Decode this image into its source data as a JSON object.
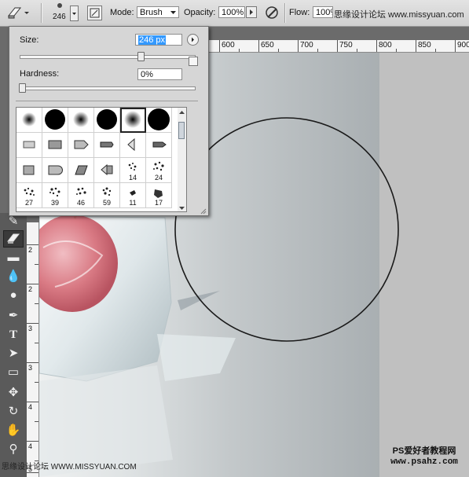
{
  "options_bar": {
    "brush_size": "246",
    "mode_label": "Mode:",
    "mode_value": "Brush",
    "opacity_label": "Opacity:",
    "opacity_value": "100%",
    "flow_label": "Flow:",
    "flow_value": "100%",
    "overlay_text": "思缘设计论坛 www.missyuan.com"
  },
  "brush_panel": {
    "size_label": "Size:",
    "size_value": "246 px",
    "size_level": 0.7,
    "hardness_label": "Hardness:",
    "hardness_value": "0%",
    "hardness_level": 0.0,
    "brush_numbers": [
      "14",
      "24",
      "27",
      "39",
      "46",
      "59",
      "11",
      "17"
    ]
  },
  "rulers": {
    "top": [
      "600",
      "650",
      "700",
      "750",
      "800",
      "850",
      "900"
    ],
    "left": [
      "2",
      "2",
      "3",
      "3",
      "4",
      "4",
      "5"
    ]
  },
  "watermarks": {
    "bottom_right_line1": "PS爱好者教程网",
    "bottom_right_line2": "www.psahz.com",
    "bottom_left": "思缘设计论坛  WWW.MISSYUAN.COM"
  },
  "colors": {
    "toolbar_bg": "#d6d6d6",
    "selection_highlight": "#3399ff",
    "brush_circle": "#1a1a1a"
  }
}
